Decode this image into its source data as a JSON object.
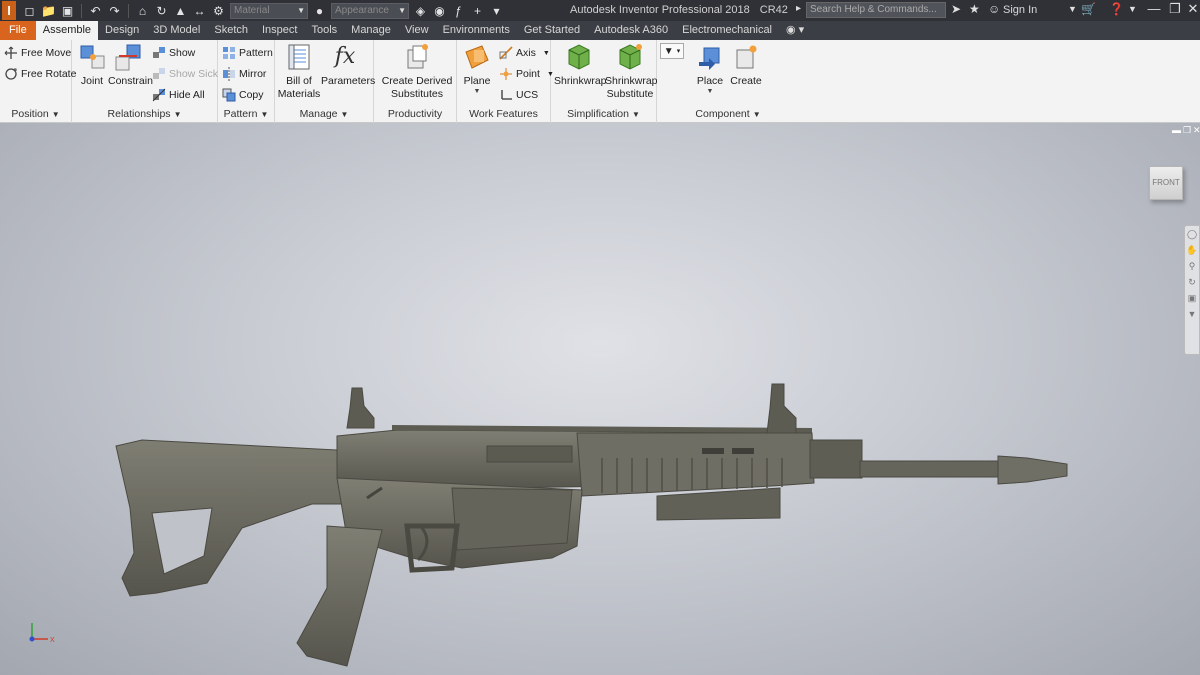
{
  "titlebar": {
    "app_title": "Autodesk Inventor Professional 2018",
    "document": "CR42",
    "search_placeholder": "Search Help & Commands...",
    "sign_in": "Sign In",
    "material_dropdown": "Material",
    "appearance_dropdown": "Appearance"
  },
  "tabs": [
    "File",
    "Assemble",
    "Design",
    "3D Model",
    "Sketch",
    "Inspect",
    "Tools",
    "Manage",
    "View",
    "Environments",
    "Get Started",
    "Autodesk A360",
    "Electromechanical"
  ],
  "active_tab": "Assemble",
  "ribbon": {
    "position": {
      "label": "Position",
      "free_move": "Free Move",
      "free_rotate": "Free Rotate"
    },
    "relationships": {
      "label": "Relationships",
      "joint": "Joint",
      "constrain": "Constrain",
      "show": "Show",
      "show_sick": "Show Sick",
      "hide_all": "Hide All"
    },
    "pattern": {
      "label": "Pattern",
      "pattern": "Pattern",
      "mirror": "Mirror",
      "copy": "Copy"
    },
    "manage": {
      "label": "Manage",
      "bom_line1": "Bill of",
      "bom_line2": "Materials",
      "parameters": "Parameters"
    },
    "productivity": {
      "label": "Productivity",
      "line1": "Create Derived",
      "line2": "Substitutes"
    },
    "work_features": {
      "label": "Work Features",
      "plane": "Plane",
      "axis": "Axis",
      "point": "Point",
      "ucs": "UCS"
    },
    "simplification": {
      "label": "Simplification",
      "shrinkwrap": "Shrinkwrap",
      "sub_line1": "Shrinkwrap",
      "sub_line2": "Substitute"
    },
    "component": {
      "label": "Component",
      "place": "Place",
      "create": "Create"
    }
  },
  "viewport": {
    "viewcube_face": "FRONT",
    "triad_x": "X"
  },
  "colors": {
    "file_tab": "#d9641d",
    "titlebar": "#2f3137",
    "ribbon": "#f3f3f3",
    "model": "#6b6a60"
  }
}
